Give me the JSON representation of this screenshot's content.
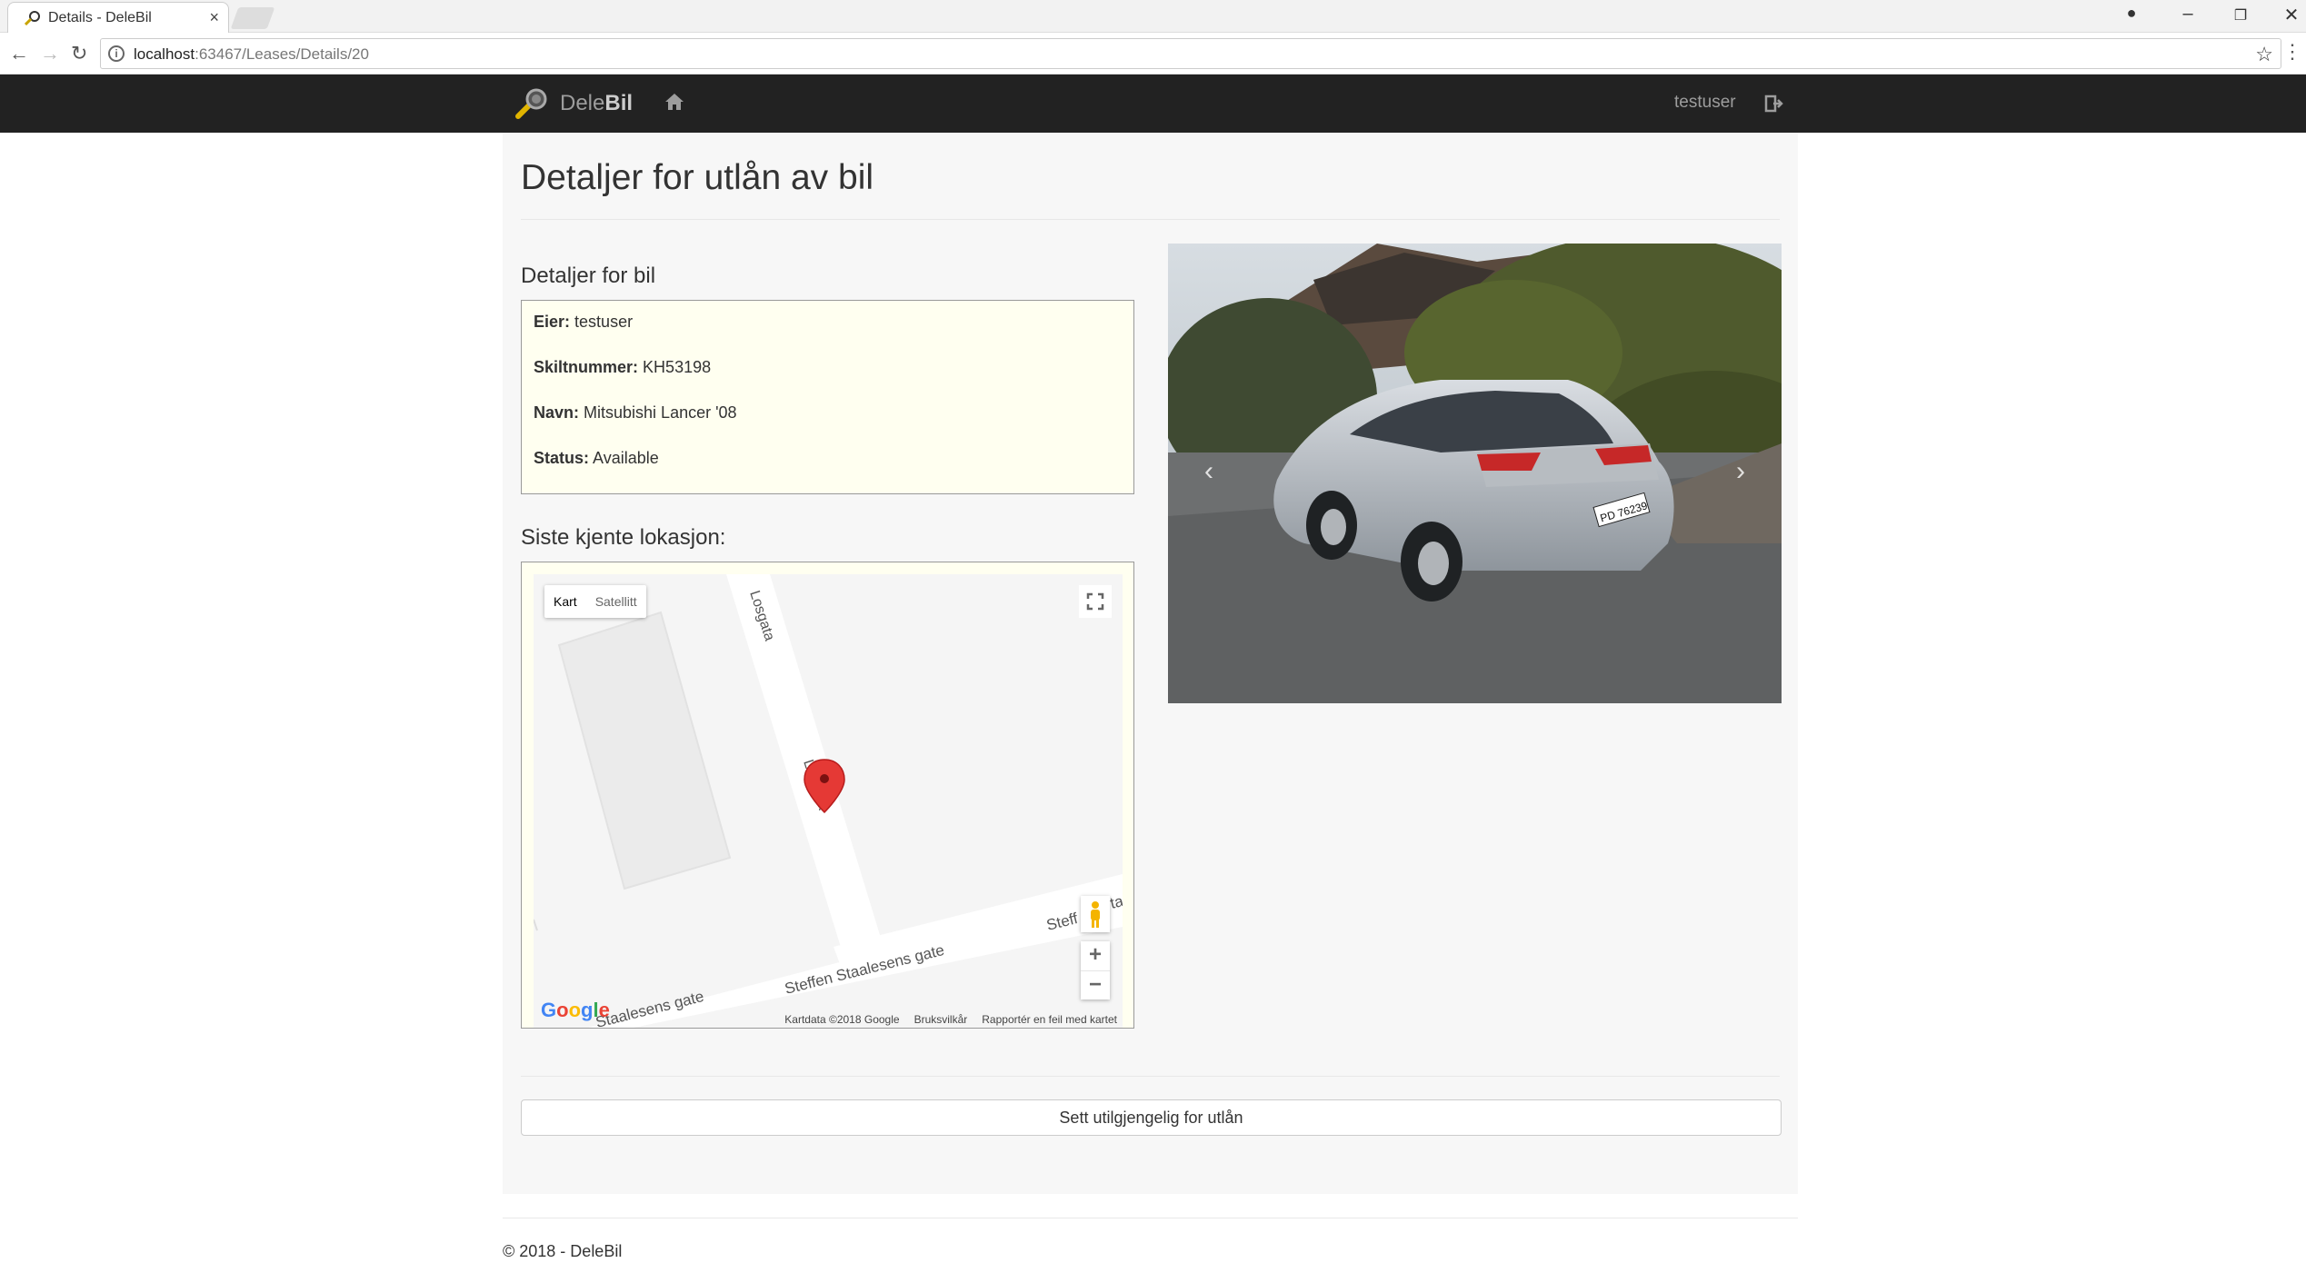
{
  "browser": {
    "tab_title": "Details - DeleBil",
    "url_host": "localhost",
    "url_path": ":63467/Leases/Details/20",
    "icons": [
      "favicon-icon",
      "close-icon",
      "back-icon",
      "forward-icon",
      "reload-icon",
      "info-icon",
      "star-icon",
      "account-icon",
      "minimize-icon",
      "restore-icon",
      "window-close-icon",
      "menu-icon"
    ]
  },
  "navbar": {
    "brand_light": "Dele",
    "brand_bold": "Bil",
    "username": "testuser"
  },
  "page": {
    "title": "Detaljer for utlån av bil",
    "details_heading": "Detaljer for bil",
    "details": [
      {
        "label": "Eier:",
        "value": "testuser"
      },
      {
        "label": "Skiltnummer:",
        "value": "KH53198"
      },
      {
        "label": "Navn:",
        "value": "Mitsubishi Lancer '08"
      },
      {
        "label": "Status:",
        "value": "Available"
      }
    ],
    "location_heading": "Siste kjente lokasjon:",
    "action_button": "Sett utilgjengelig for utlån"
  },
  "map": {
    "type_map": "Kart",
    "type_satellite": "Satellitt",
    "street_1": "Losgata",
    "street_1b": "Losgata",
    "street_2": "Steffen Staalesens gate",
    "street_2b": "Staalesens gate",
    "street_2c": "Steff",
    "street_2d": "ta",
    "zoom_in": "+",
    "zoom_out": "−",
    "logo": "Google",
    "attribution": "Kartdata ©2018 Google",
    "terms": "Bruksvilkår",
    "report": "Rapportér en feil med kartet"
  },
  "carousel": {
    "prev": "‹",
    "next": "›",
    "plate": "PD 76239"
  },
  "footer": {
    "text": "© 2018 - DeleBil"
  }
}
